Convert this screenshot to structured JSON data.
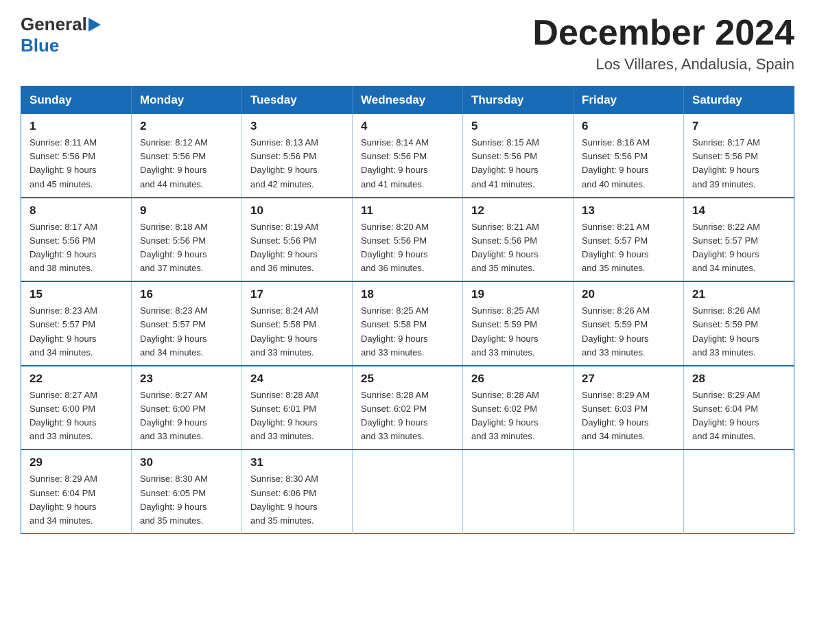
{
  "header": {
    "logo_general": "General",
    "logo_blue": "Blue",
    "month_title": "December 2024",
    "location": "Los Villares, Andalusia, Spain"
  },
  "columns": [
    "Sunday",
    "Monday",
    "Tuesday",
    "Wednesday",
    "Thursday",
    "Friday",
    "Saturday"
  ],
  "weeks": [
    [
      {
        "day": "1",
        "sunrise": "8:11 AM",
        "sunset": "5:56 PM",
        "daylight": "9 hours and 45 minutes."
      },
      {
        "day": "2",
        "sunrise": "8:12 AM",
        "sunset": "5:56 PM",
        "daylight": "9 hours and 44 minutes."
      },
      {
        "day": "3",
        "sunrise": "8:13 AM",
        "sunset": "5:56 PM",
        "daylight": "9 hours and 42 minutes."
      },
      {
        "day": "4",
        "sunrise": "8:14 AM",
        "sunset": "5:56 PM",
        "daylight": "9 hours and 41 minutes."
      },
      {
        "day": "5",
        "sunrise": "8:15 AM",
        "sunset": "5:56 PM",
        "daylight": "9 hours and 41 minutes."
      },
      {
        "day": "6",
        "sunrise": "8:16 AM",
        "sunset": "5:56 PM",
        "daylight": "9 hours and 40 minutes."
      },
      {
        "day": "7",
        "sunrise": "8:17 AM",
        "sunset": "5:56 PM",
        "daylight": "9 hours and 39 minutes."
      }
    ],
    [
      {
        "day": "8",
        "sunrise": "8:17 AM",
        "sunset": "5:56 PM",
        "daylight": "9 hours and 38 minutes."
      },
      {
        "day": "9",
        "sunrise": "8:18 AM",
        "sunset": "5:56 PM",
        "daylight": "9 hours and 37 minutes."
      },
      {
        "day": "10",
        "sunrise": "8:19 AM",
        "sunset": "5:56 PM",
        "daylight": "9 hours and 36 minutes."
      },
      {
        "day": "11",
        "sunrise": "8:20 AM",
        "sunset": "5:56 PM",
        "daylight": "9 hours and 36 minutes."
      },
      {
        "day": "12",
        "sunrise": "8:21 AM",
        "sunset": "5:56 PM",
        "daylight": "9 hours and 35 minutes."
      },
      {
        "day": "13",
        "sunrise": "8:21 AM",
        "sunset": "5:57 PM",
        "daylight": "9 hours and 35 minutes."
      },
      {
        "day": "14",
        "sunrise": "8:22 AM",
        "sunset": "5:57 PM",
        "daylight": "9 hours and 34 minutes."
      }
    ],
    [
      {
        "day": "15",
        "sunrise": "8:23 AM",
        "sunset": "5:57 PM",
        "daylight": "9 hours and 34 minutes."
      },
      {
        "day": "16",
        "sunrise": "8:23 AM",
        "sunset": "5:57 PM",
        "daylight": "9 hours and 34 minutes."
      },
      {
        "day": "17",
        "sunrise": "8:24 AM",
        "sunset": "5:58 PM",
        "daylight": "9 hours and 33 minutes."
      },
      {
        "day": "18",
        "sunrise": "8:25 AM",
        "sunset": "5:58 PM",
        "daylight": "9 hours and 33 minutes."
      },
      {
        "day": "19",
        "sunrise": "8:25 AM",
        "sunset": "5:59 PM",
        "daylight": "9 hours and 33 minutes."
      },
      {
        "day": "20",
        "sunrise": "8:26 AM",
        "sunset": "5:59 PM",
        "daylight": "9 hours and 33 minutes."
      },
      {
        "day": "21",
        "sunrise": "8:26 AM",
        "sunset": "5:59 PM",
        "daylight": "9 hours and 33 minutes."
      }
    ],
    [
      {
        "day": "22",
        "sunrise": "8:27 AM",
        "sunset": "6:00 PM",
        "daylight": "9 hours and 33 minutes."
      },
      {
        "day": "23",
        "sunrise": "8:27 AM",
        "sunset": "6:00 PM",
        "daylight": "9 hours and 33 minutes."
      },
      {
        "day": "24",
        "sunrise": "8:28 AM",
        "sunset": "6:01 PM",
        "daylight": "9 hours and 33 minutes."
      },
      {
        "day": "25",
        "sunrise": "8:28 AM",
        "sunset": "6:02 PM",
        "daylight": "9 hours and 33 minutes."
      },
      {
        "day": "26",
        "sunrise": "8:28 AM",
        "sunset": "6:02 PM",
        "daylight": "9 hours and 33 minutes."
      },
      {
        "day": "27",
        "sunrise": "8:29 AM",
        "sunset": "6:03 PM",
        "daylight": "9 hours and 34 minutes."
      },
      {
        "day": "28",
        "sunrise": "8:29 AM",
        "sunset": "6:04 PM",
        "daylight": "9 hours and 34 minutes."
      }
    ],
    [
      {
        "day": "29",
        "sunrise": "8:29 AM",
        "sunset": "6:04 PM",
        "daylight": "9 hours and 34 minutes."
      },
      {
        "day": "30",
        "sunrise": "8:30 AM",
        "sunset": "6:05 PM",
        "daylight": "9 hours and 35 minutes."
      },
      {
        "day": "31",
        "sunrise": "8:30 AM",
        "sunset": "6:06 PM",
        "daylight": "9 hours and 35 minutes."
      },
      null,
      null,
      null,
      null
    ]
  ],
  "labels": {
    "sunrise": "Sunrise:",
    "sunset": "Sunset:",
    "daylight": "Daylight:"
  }
}
